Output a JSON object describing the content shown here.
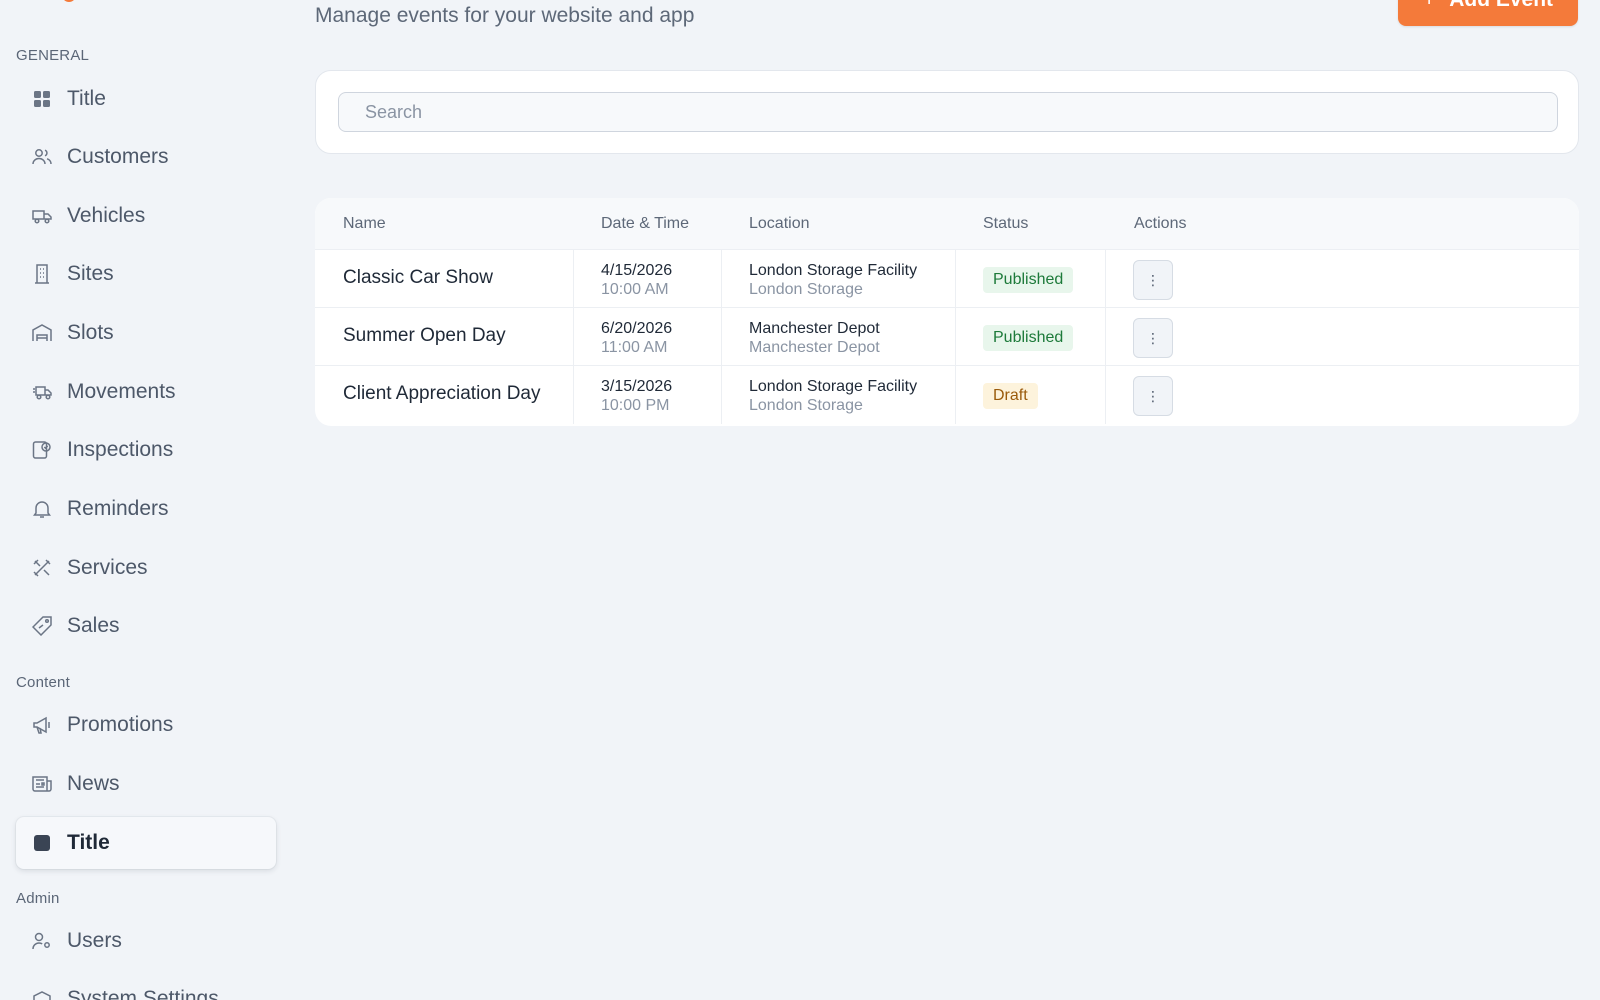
{
  "sidebar": {
    "sections": [
      {
        "label": "GENERAL"
      },
      {
        "label": "Content"
      },
      {
        "label": "Admin"
      }
    ],
    "items": [
      {
        "label": "Title",
        "icon": "grid-icon"
      },
      {
        "label": "Customers",
        "icon": "users-icon"
      },
      {
        "label": "Vehicles",
        "icon": "truck-icon"
      },
      {
        "label": "Sites",
        "icon": "building-icon"
      },
      {
        "label": "Slots",
        "icon": "garage-icon"
      },
      {
        "label": "Movements",
        "icon": "delivery-truck-icon"
      },
      {
        "label": "Inspections",
        "icon": "clipboard-check-icon"
      },
      {
        "label": "Reminders",
        "icon": "bell-icon"
      },
      {
        "label": "Services",
        "icon": "tools-icon"
      },
      {
        "label": "Sales",
        "icon": "tag-icon"
      },
      {
        "label": "Promotions",
        "icon": "megaphone-icon"
      },
      {
        "label": "News",
        "icon": "newspaper-icon"
      },
      {
        "label": "Title",
        "icon": "square-icon",
        "active": true
      },
      {
        "label": "Users",
        "icon": "user-cog-icon"
      },
      {
        "label": "System Settings",
        "icon": "settings-icon"
      }
    ]
  },
  "header": {
    "subtitle": "Manage events for your website and app",
    "add_label": "Add Event"
  },
  "search": {
    "placeholder": "Search"
  },
  "table": {
    "columns": [
      "Name",
      "Date & Time",
      "Location",
      "Status",
      "Actions"
    ],
    "rows": [
      {
        "name": "Classic Car Show",
        "date": "4/15/2026",
        "time": "10:00 AM",
        "location": "London Storage Facility",
        "location_sub": "London Storage",
        "status": "Published"
      },
      {
        "name": "Summer Open Day",
        "date": "6/20/2026",
        "time": "11:00 AM",
        "location": "Manchester Depot",
        "location_sub": "Manchester Depot",
        "status": "Published"
      },
      {
        "name": "Client Appreciation Day",
        "date": "3/15/2026",
        "time": "10:00 PM",
        "location": "London Storage Facility",
        "location_sub": "London Storage",
        "status": "Draft"
      }
    ]
  },
  "colors": {
    "accent": "#f47a3a",
    "published_bg": "#e8f6ec",
    "published_text": "#1d7a3a",
    "draft_bg": "#fdf3dc",
    "draft_text": "#9a5b0c"
  }
}
